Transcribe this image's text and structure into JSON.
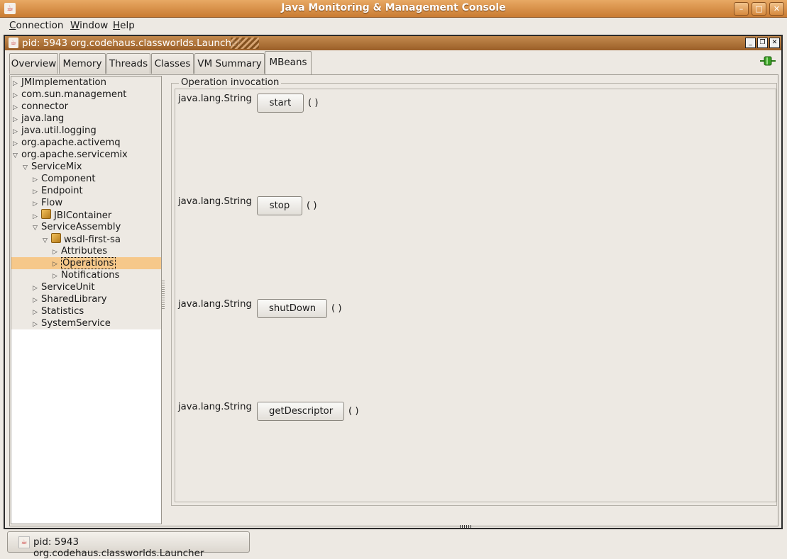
{
  "window": {
    "title": "Java Monitoring & Management Console",
    "controls": [
      "minimize-icon",
      "maximize-icon",
      "close-icon"
    ]
  },
  "menubar": {
    "items": [
      "Connection",
      "Window",
      "Help"
    ]
  },
  "internal_frame": {
    "title": "pid: 5943 org.codehaus.classworlds.Launcher"
  },
  "tabs": [
    {
      "label": "Overview"
    },
    {
      "label": "Memory"
    },
    {
      "label": "Threads"
    },
    {
      "label": "Classes"
    },
    {
      "label": "VM Summary"
    },
    {
      "label": "MBeans",
      "active": true
    }
  ],
  "tree": {
    "items": [
      {
        "label": "JMImplementation",
        "expanded": false
      },
      {
        "label": "com.sun.management",
        "expanded": false
      },
      {
        "label": "connector",
        "expanded": false
      },
      {
        "label": "java.lang",
        "expanded": false
      },
      {
        "label": "java.util.logging",
        "expanded": false
      },
      {
        "label": "org.apache.activemq",
        "expanded": false
      },
      {
        "label": "org.apache.servicemix",
        "expanded": true
      },
      {
        "label": "ServiceMix",
        "expanded": true
      },
      {
        "label": "Component",
        "expanded": false
      },
      {
        "label": "Endpoint",
        "expanded": false
      },
      {
        "label": "Flow",
        "expanded": false
      },
      {
        "label": "JBIContainer",
        "expanded": false,
        "icon": "mbean-icon"
      },
      {
        "label": "ServiceAssembly",
        "expanded": true
      },
      {
        "label": "wsdl-first-sa",
        "expanded": true,
        "icon": "mbean-icon"
      },
      {
        "label": "Attributes",
        "expanded": false
      },
      {
        "label": "Operations",
        "expanded": false,
        "selected": true
      },
      {
        "label": "Notifications",
        "expanded": false
      },
      {
        "label": "ServiceUnit",
        "expanded": false
      },
      {
        "label": "SharedLibrary",
        "expanded": false
      },
      {
        "label": "Statistics",
        "expanded": false
      },
      {
        "label": "SystemService",
        "expanded": false
      }
    ]
  },
  "operations": {
    "title": "Operation invocation",
    "items": [
      {
        "return_type": "java.lang.String",
        "name": "start",
        "params": "( )"
      },
      {
        "return_type": "java.lang.String",
        "name": "stop",
        "params": "( )"
      },
      {
        "return_type": "java.lang.String",
        "name": "shutDown",
        "params": "( )"
      },
      {
        "return_type": "java.lang.String",
        "name": "getDescriptor",
        "params": "( )"
      }
    ]
  },
  "taskbar": {
    "label": "pid: 5943 org.codehaus.classworlds.Launcher"
  },
  "colors": {
    "title_orange": "#d6893e",
    "selection": "#f6c88a",
    "connect_green": "#3aa025"
  }
}
